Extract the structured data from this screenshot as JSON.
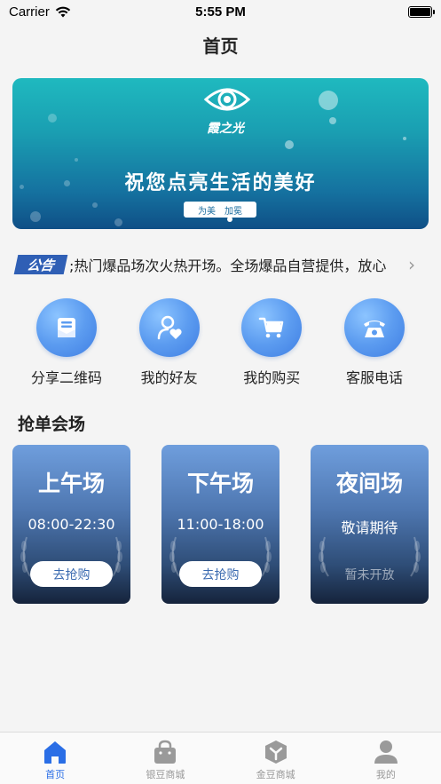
{
  "status_bar": {
    "carrier": "Carrier",
    "time": "5:55 PM"
  },
  "nav": {
    "title": "首页"
  },
  "banner": {
    "brand": "霞之光",
    "slogan": "祝您点亮生活的美好",
    "tag_left": "为美",
    "tag_right": "加冕"
  },
  "notice": {
    "badge": "公告",
    "text": ";热门爆品场次火热开场。全场爆品自营提供，放心",
    "arrow": "›"
  },
  "shortcuts": [
    {
      "label": "分享二维码",
      "icon": "envelope-icon"
    },
    {
      "label": "我的好友",
      "icon": "friend-heart-icon"
    },
    {
      "label": "我的购买",
      "icon": "cart-icon"
    },
    {
      "label": "客服电话",
      "icon": "telephone-icon"
    }
  ],
  "section": {
    "title": "抢单会场"
  },
  "sessions": [
    {
      "title": "上午场",
      "subtitle": "08:00-22:30",
      "button": "去抢购",
      "enabled": true
    },
    {
      "title": "下午场",
      "subtitle": "11:00-18:00",
      "button": "去抢购",
      "enabled": true
    },
    {
      "title": "夜间场",
      "subtitle": "敬请期待",
      "button": "暂未开放",
      "enabled": false
    }
  ],
  "tabbar": [
    {
      "label": "首页",
      "icon": "home-icon",
      "active": true
    },
    {
      "label": "银豆商城",
      "icon": "bag-icon",
      "active": false
    },
    {
      "label": "金豆商城",
      "icon": "cube-icon",
      "active": false
    },
    {
      "label": "我的",
      "icon": "user-icon",
      "active": false
    }
  ],
  "colors": {
    "accent": "#2a6ee6",
    "notice_badge": "#2f5fb5",
    "card_top": "#6f9edd",
    "card_bottom": "#15233b",
    "banner_top": "#1fb9bf"
  }
}
